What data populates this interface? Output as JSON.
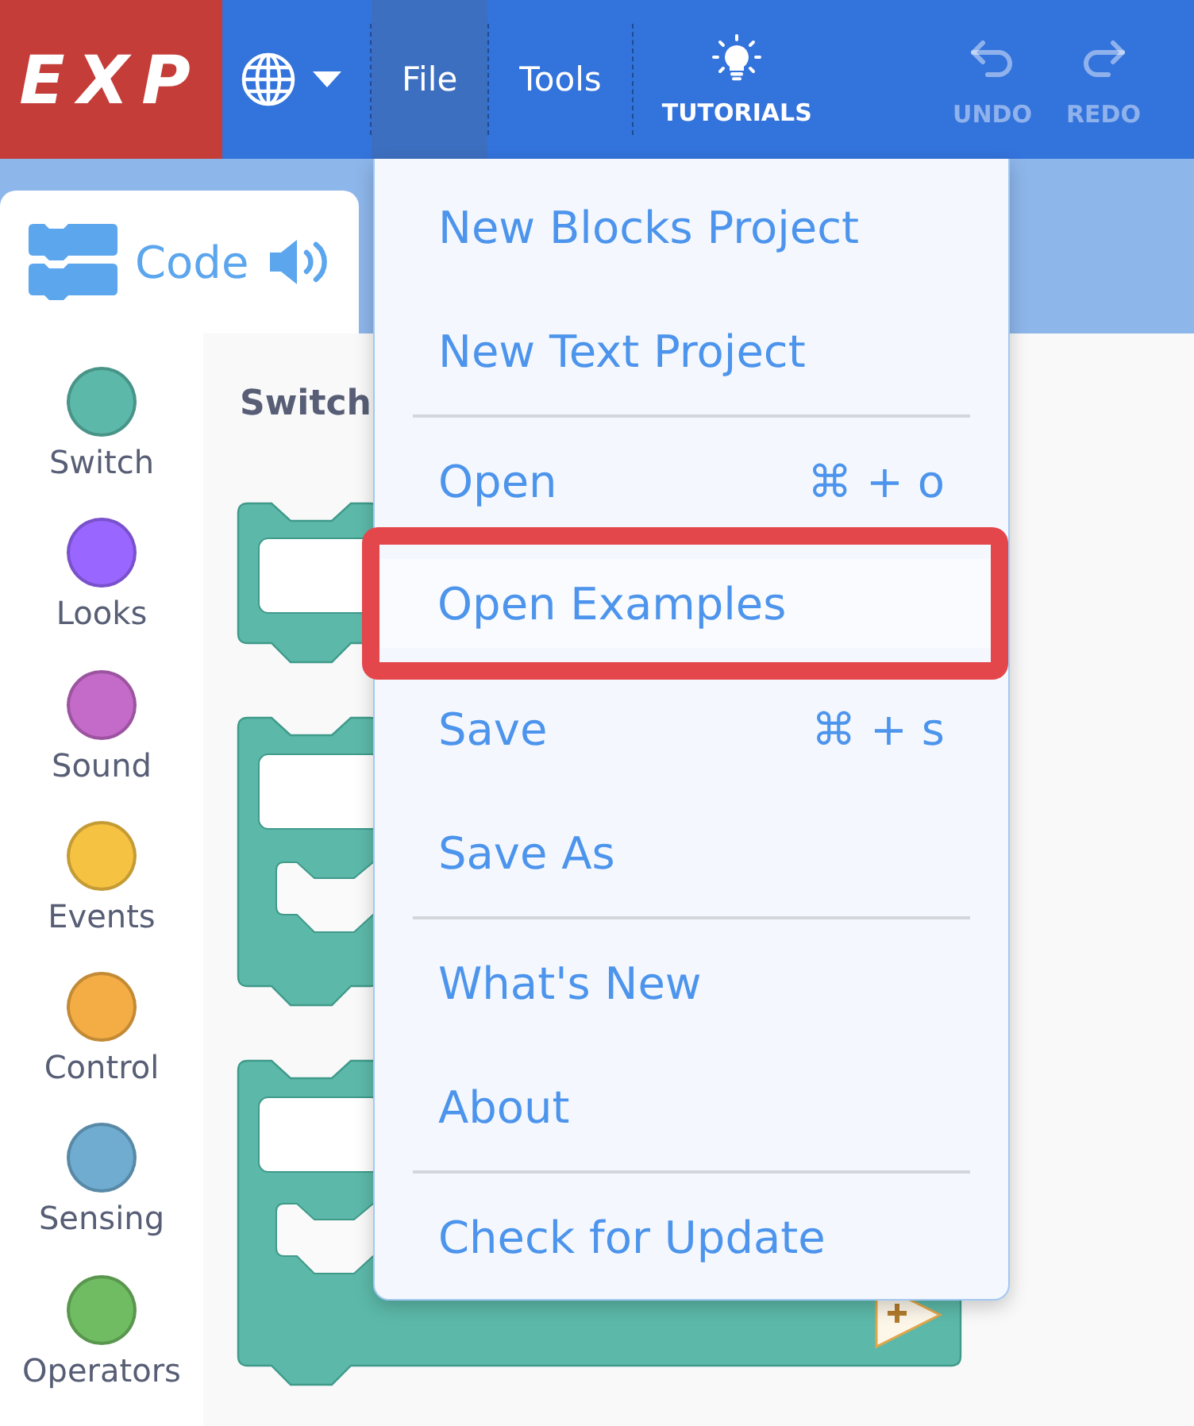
{
  "header": {
    "logo": "EXP",
    "menus": [
      {
        "label": "File",
        "selected": true
      },
      {
        "label": "Tools",
        "selected": false
      }
    ],
    "tutorials": "TUTORIALS",
    "history": [
      {
        "kind": "undo",
        "label": "UNDO",
        "disabled": true
      },
      {
        "kind": "redo",
        "label": "REDO",
        "disabled": true
      }
    ]
  },
  "tabs": [
    {
      "label": "Code",
      "selected": true
    }
  ],
  "categories": [
    {
      "label": "Switch",
      "color": "#5cb9aa"
    },
    {
      "label": "Looks",
      "color": "#9966ff"
    },
    {
      "label": "Sound",
      "color": "#c46ac8"
    },
    {
      "label": "Events",
      "color": "#f5c242"
    },
    {
      "label": "Control",
      "color": "#f4ad44"
    },
    {
      "label": "Sensing",
      "color": "#6facd0"
    },
    {
      "label": "Operators",
      "color": "#70bc62"
    }
  ],
  "palette": {
    "heading": "Switch",
    "blocks": [
      {
        "kind": "single"
      },
      {
        "kind": "c-shape"
      },
      {
        "kind": "c-shape-plus"
      }
    ]
  },
  "file_menu": {
    "items": [
      {
        "kind": "item",
        "label": "New Blocks Project",
        "highlighted": false
      },
      {
        "kind": "item",
        "label": "New Text Project",
        "highlighted": false
      },
      {
        "kind": "separator"
      },
      {
        "kind": "item",
        "label": "Open",
        "shortcut": "⌘ + o",
        "highlighted": false
      },
      {
        "kind": "item",
        "label": "Open Examples",
        "highlighted": true
      },
      {
        "kind": "item",
        "label": "Save",
        "shortcut": "⌘ + s",
        "highlighted": false
      },
      {
        "kind": "item",
        "label": "Save As",
        "highlighted": false
      },
      {
        "kind": "separator"
      },
      {
        "kind": "item",
        "label": "What's New",
        "highlighted": false
      },
      {
        "kind": "item",
        "label": "About",
        "highlighted": false
      },
      {
        "kind": "separator"
      },
      {
        "kind": "item",
        "label": "Check for Update",
        "highlighted": false
      }
    ]
  }
}
